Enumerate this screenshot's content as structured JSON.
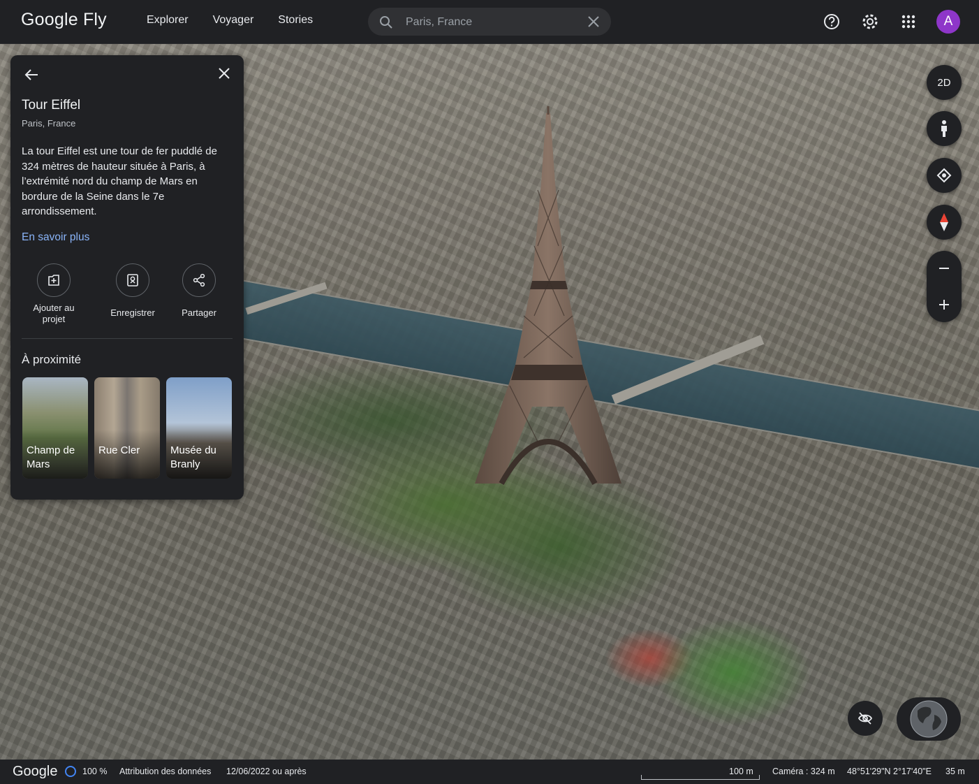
{
  "app": {
    "logo": "Google Fly"
  },
  "nav": {
    "items": [
      "Explorer",
      "Voyager",
      "Stories"
    ]
  },
  "search": {
    "placeholder": "Paris, France",
    "value": ""
  },
  "user": {
    "avatar_letter": "A",
    "avatar_color": "#8e36c9"
  },
  "panel": {
    "title": "Tour Eiffel",
    "subtitle": "Paris, France",
    "description": "La tour Eiffel est une tour de fer puddlé de 324 mètres de hauteur située à Paris, à l’extrémité nord du champ de Mars en bordure de la Seine dans le 7e arrondissement.",
    "learn_more": "En savoir plus",
    "actions": [
      {
        "label": "Ajouter au projet",
        "icon": "add-to-project-icon"
      },
      {
        "label": "Enregistrer",
        "icon": "bookmark-icon"
      },
      {
        "label": "Partager",
        "icon": "share-icon"
      }
    ],
    "nearby_title": "À proximité",
    "nearby": [
      {
        "name": "Champ de Mars"
      },
      {
        "name": "Rue Cler"
      },
      {
        "name": "Musée du Branly"
      }
    ]
  },
  "controls": {
    "view_toggle": "2D"
  },
  "footer": {
    "logo": "Google",
    "zoom_percent": "100 %",
    "attribution": "Attribution des données",
    "imagery_date": "12/06/2022 ou après",
    "scale_label": "100 m",
    "camera": "Caméra : 324 m",
    "coords": "48°51'29\"N 2°17'40\"E",
    "elevation": "35 m"
  },
  "colors": {
    "accent_link": "#8ab4f8",
    "panel_bg": "#202124"
  }
}
